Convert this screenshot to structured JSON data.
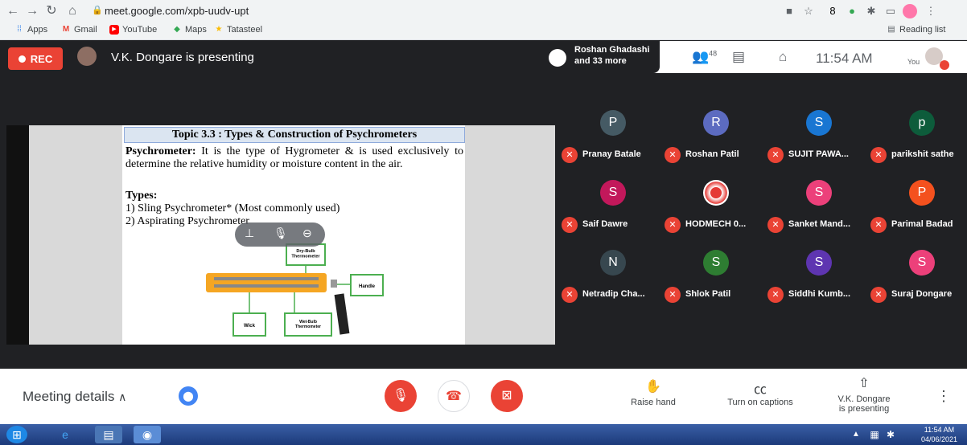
{
  "browser": {
    "url": "meet.google.com/xpb-uudv-upt",
    "bookmarks": [
      "Apps",
      "Gmail",
      "YouTube",
      "Maps",
      "Tatasteel"
    ],
    "reading_list": "Reading list"
  },
  "meet": {
    "rec_label": "REC",
    "presenting_label": "V.K. Dongare is presenting",
    "participant_chip": {
      "line1": "Roshan Ghadashi",
      "line2": "and 33 more"
    },
    "participant_count": "48",
    "time": "11:54 AM",
    "you_label": "You"
  },
  "slide": {
    "title": "Topic 3.3 : Types & Construction of Psychrometers",
    "definition_term": "Psychrometer:",
    "definition_text": " It is the type of Hygrometer & is used exclusively to determine the relative humidity or moisture content in the air.",
    "types_heading": "Types:",
    "type1": "1)  Sling Psychrometer* (Most commonly used)",
    "type2": "2)  Aspirating Psychrometer",
    "labels": {
      "dry_bulb": "Dry-Bulb Thermometer",
      "handle": "Handle",
      "wick": "Wick",
      "wet_bulb": "Wet-Bulb Thermometer"
    }
  },
  "tiles": [
    {
      "initial": "P",
      "name": "Pranay Batale",
      "color": "#455a64"
    },
    {
      "initial": "R",
      "name": "Roshan Patil",
      "color": "#5c6bc0"
    },
    {
      "initial": "S",
      "name": "SUJIT PAWA...",
      "color": "#1976d2"
    },
    {
      "initial": "p",
      "name": "parikshit sathe",
      "color": "#0d5c3b"
    },
    {
      "initial": "S",
      "name": "Saif Dawre",
      "color": "#c2185b"
    },
    {
      "initial": "",
      "name": "HODMECH 0...",
      "color": "#ffffff"
    },
    {
      "initial": "S",
      "name": "Sanket Mand...",
      "color": "#ec407a"
    },
    {
      "initial": "P",
      "name": "Parimal Badad",
      "color": "#f4511e"
    },
    {
      "initial": "N",
      "name": "Netradip Cha...",
      "color": "#37474f"
    },
    {
      "initial": "S",
      "name": "Shlok Patil",
      "color": "#2e7d32"
    },
    {
      "initial": "S",
      "name": "Siddhi Kumb...",
      "color": "#5e35b1"
    },
    {
      "initial": "S",
      "name": "Suraj Dongare",
      "color": "#ec407a"
    }
  ],
  "bottom": {
    "meeting_details": "Meeting details",
    "raise_hand": "Raise hand",
    "captions": "Turn on captions",
    "presenting_line1": "V.K. Dongare",
    "presenting_line2": "is presenting"
  },
  "taskbar": {
    "time": "11:54 AM",
    "date": "04/06/2021"
  }
}
